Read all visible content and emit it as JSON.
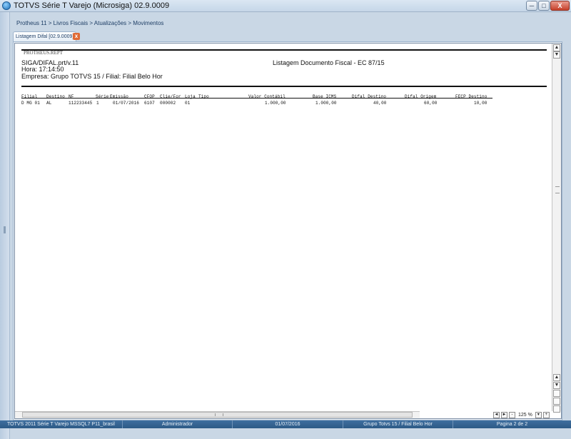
{
  "window": {
    "title": "TOTVS Série T Varejo (Microsiga) 02.9.0009",
    "min_label": "─",
    "max_label": "□",
    "close_label": "X"
  },
  "breadcrumb": "Protheus 11 > Livros Fiscais > Atualizações > Movimentos",
  "tab": {
    "label": "Listagem Difal [02.9.0009]",
    "close_label": "x"
  },
  "report": {
    "stamp": "PROTHEUS.REPT",
    "program": "SIGA/DIFAL.prt/v.11",
    "title": "Listagem Documento Fiscal - EC 87/15",
    "time": "Hora: 17:14:50",
    "company": "Empresa: Grupo TOTVS 15 / Filial: Filial Belo Hor",
    "columns": {
      "filial": "Filial",
      "destino": "Destino",
      "nf": "NF",
      "serie": "Série",
      "emissao": "Emissão",
      "cfop": "CFOP",
      "cli_for": "Clie/For",
      "loja": "Loja",
      "tipo": "Tipo",
      "valor_contabil": "Valor Contábil",
      "base_icms": "Base ICMS",
      "difal_destino": "Difal Destino",
      "difal_origem": "Difal Origem",
      "fecp_destino": "FECP Destino"
    },
    "row": {
      "filial": "D MG 01",
      "destino": "AL",
      "nf": "112233445",
      "serie": "1",
      "emissao": "01/07/2016",
      "cfop": "6107",
      "cli_for": "000002",
      "loja": "01",
      "valor_contabil": "1.000,00",
      "base_icms": "1.000,00",
      "difal_destino": "40,00",
      "difal_origem": "60,00",
      "fecp_destino": "10,00"
    }
  },
  "viewer": {
    "zoom": "125 %",
    "scroll_up": "▲",
    "scroll_down": "▼",
    "page_prev": "◄",
    "page_next": "►"
  },
  "statusbar": {
    "system": "TOTVS 2011 Série T Varejo MSSQL7 P11_brasil",
    "user": "Administrador",
    "date": "01/07/2016",
    "company": "Grupo Totvs 15 / Filial Belo Hor",
    "page": "Pagina 2 de 2"
  }
}
